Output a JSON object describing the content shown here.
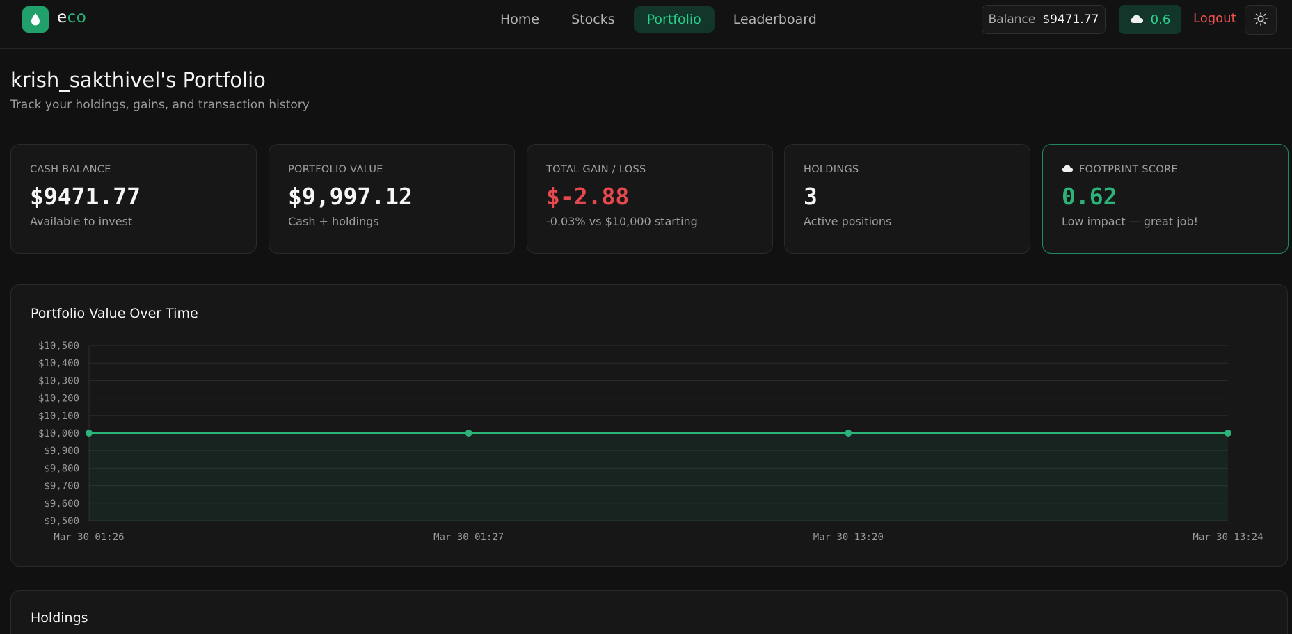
{
  "nav": {
    "logo_part1": "e",
    "logo_part2": "co",
    "links": [
      {
        "label": "Home",
        "active": false
      },
      {
        "label": "Stocks",
        "active": false
      },
      {
        "label": "Portfolio",
        "active": true
      },
      {
        "label": "Leaderboard",
        "active": false
      }
    ],
    "balance_label": "Balance",
    "balance_value": "$9471.77",
    "footprint_value": "0.6",
    "logout_label": "Logout",
    "theme_icon": "sun-icon"
  },
  "header": {
    "title": "krish_sakthivel's Portfolio",
    "subtitle": "Track your holdings, gains, and transaction history"
  },
  "cards": [
    {
      "label": "CASH BALANCE",
      "value": "$9471.77",
      "sub": "Available to invest",
      "tone": "default"
    },
    {
      "label": "PORTFOLIO VALUE",
      "value": "$9,997.12",
      "sub": "Cash + holdings",
      "tone": "default"
    },
    {
      "label": "TOTAL GAIN / LOSS",
      "value": "$-2.88",
      "sub": "-0.03% vs $10,000 starting",
      "tone": "red"
    },
    {
      "label": "HOLDINGS",
      "value": "3",
      "sub": "Active positions",
      "tone": "default"
    },
    {
      "label": "FOOTPRINT SCORE",
      "value": "0.62",
      "sub": "Low impact — great job!",
      "tone": "green"
    }
  ],
  "chart_panel": {
    "title": "Portfolio Value Over Time"
  },
  "holdings_panel": {
    "title": "Holdings"
  },
  "colors": {
    "accent": "#2bb37a",
    "negative": "#e5484d",
    "background": "#111111",
    "card": "#171717"
  },
  "chart_data": {
    "type": "line",
    "title": "Portfolio Value Over Time",
    "xlabel": "",
    "ylabel": "",
    "x": [
      "Mar 30 01:26",
      "Mar 30 01:27",
      "Mar 30 13:20",
      "Mar 30 13:24"
    ],
    "series": [
      {
        "values": [
          10000,
          10000,
          10000,
          10000
        ]
      }
    ],
    "yticks": [
      "$10,500",
      "$10,400",
      "$10,300",
      "$10,200",
      "$10,100",
      "$10,000",
      "$9,900",
      "$9,800",
      "$9,700",
      "$9,600",
      "$9,500"
    ],
    "ylim": [
      9500,
      10500
    ],
    "grid": true,
    "area_fill": true
  }
}
